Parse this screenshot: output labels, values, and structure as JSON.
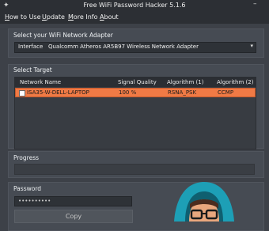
{
  "window": {
    "title": "Free WiFi Password Hacker 5.1.6"
  },
  "menu": [
    {
      "underline": "H",
      "rest": "ow to Use"
    },
    {
      "underline": "U",
      "rest": "pdate"
    },
    {
      "underline": "M",
      "rest": "ore Info"
    },
    {
      "underline": "A",
      "rest": "bout"
    }
  ],
  "adapter_section": {
    "label": "Select your WiFi Network Adapter",
    "interface_label": "Interface",
    "interface_value": "Qualcomm Atheros AR5B97 Wireless Network Adapter"
  },
  "target_section": {
    "label": "Select Target",
    "columns": [
      "Network Name",
      "Signal Quality",
      "Algorithm (1)",
      "Algorithm (2)"
    ],
    "rows": [
      {
        "name": "ISA35-W-DELL-LAPTOP",
        "signal": "100 %",
        "alg1": "RSNA_PSK",
        "alg2": "CCMP"
      }
    ]
  },
  "progress_section": {
    "label": "Progress"
  },
  "password_section": {
    "label": "Password",
    "masked_value": "••••••••••",
    "copy_label": "Copy"
  },
  "colors": {
    "accent": "#f07a45",
    "bg": "#3d4148",
    "panel": "#464b53",
    "hoodie": "#1d9fb6"
  }
}
